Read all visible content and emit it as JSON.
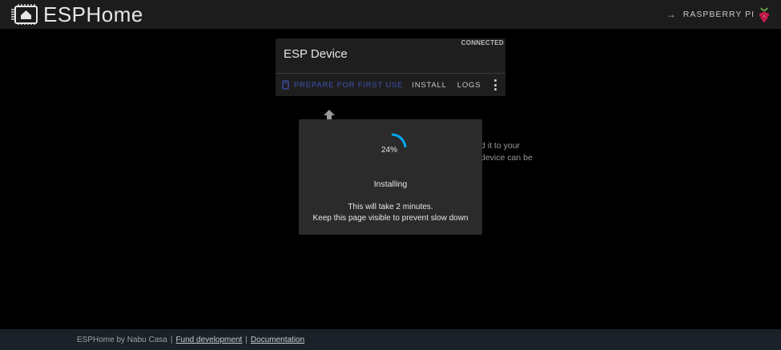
{
  "header": {
    "title": "ESPHome",
    "platform_label": "RASPBERRY PI",
    "logo_icon": "esphome-logo-icon",
    "platform_icon": "raspberry-pi-icon",
    "arrow_glyph": "→"
  },
  "device_card": {
    "status": "CONNECTED",
    "title": "ESP Device",
    "actions": {
      "prepare_label": "PREPARE FOR FIRST USE",
      "install_label": "INSTALL",
      "logs_label": "LOGS"
    },
    "prepare_icon": "usb-device-icon",
    "more_icon": "more-vertical-icon",
    "colors": {
      "primary_action": "#3f51b5"
    }
  },
  "background_text": {
    "line1": "d it to your",
    "line2": "device can be"
  },
  "install_dialog": {
    "progress_label": "24%",
    "progress_fraction": 0.24,
    "title": "Installing",
    "line1": "This will take 2 minutes.",
    "line2": "Keep this page visible to prevent slow down",
    "colors": {
      "spinner": "#03a9f4"
    }
  },
  "footer": {
    "credit": "ESPHome by Nabu Casa",
    "separator": "|",
    "fund_link": "Fund development",
    "docs_link": "Documentation"
  }
}
